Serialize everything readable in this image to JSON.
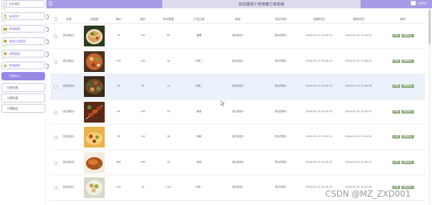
{
  "header": {
    "left_text": "美食\n系统",
    "title": "欢迎使用个体快餐订单系统",
    "user": "admin"
  },
  "sidebar": {
    "items": [
      {
        "label": "后台首页",
        "style": "normal"
      },
      {
        "label": "查询用户",
        "style": "purple"
      },
      {
        "label": "商城管理",
        "style": "purple"
      },
      {
        "label": "美食分类管理",
        "style": "purple"
      },
      {
        "label": "消费管理",
        "style": "purple"
      },
      {
        "label": "商城管理",
        "style": "purple"
      },
      {
        "label": "订餐中心",
        "style": "active"
      },
      {
        "label": "付账列表",
        "style": "sub"
      },
      {
        "label": "订餐列表",
        "style": "sub"
      },
      {
        "label": "订餐配送",
        "style": "sub"
      }
    ]
  },
  "table": {
    "columns": [
      "",
      "名称",
      "封面图",
      "单价",
      "原价",
      "库存数量",
      "产品分类",
      "描述",
      "购买须知",
      "创建时间",
      "更新时间",
      "操作"
    ],
    "buttons": {
      "detail": "详情",
      "review": "查看评论"
    },
    "rows": [
      {
        "name": "供应商品1",
        "price": "99",
        "orig": "130",
        "stock": "80",
        "category": "套餐",
        "desc": "供应商品1",
        "notice": "购买须知1",
        "created": "2024-01-23 12:25:13",
        "updated": "2024-01-23 12:31:22",
        "img": "dish-noodle"
      },
      {
        "name": "供应商品2",
        "price": "150",
        "orig": "220",
        "stock": "16",
        "category": "分类二",
        "desc": "供应商品2",
        "notice": "购买须知2",
        "created": "2024-01-23 12:25:13",
        "updated": "2024-01-23 12:28:45",
        "img": "dish-bowl"
      },
      {
        "name": "供应商品3",
        "price": "10",
        "orig": "20",
        "stock": "10",
        "category": "分类二",
        "desc": "供应商品3",
        "notice": "购买须知3",
        "created": "2024-01-23 12:25:13",
        "updated": "2024-01-23 12:28:55",
        "img": "dish-platter"
      },
      {
        "name": "供应商品4",
        "price": "99",
        "orig": "199",
        "stock": "20",
        "category": "套餐",
        "desc": "供应商品4",
        "notice": "购买须知4",
        "created": "2024-01-23 12:25:13",
        "updated": "2024-01-23 12:31:27",
        "img": "dish-skewer"
      },
      {
        "name": "供应商品5",
        "price": "99",
        "orig": "110",
        "stock": "36",
        "category": "海鲜",
        "desc": "供应商品5",
        "notice": "购买须知5",
        "created": "2024-01-23 12:25:13",
        "updated": "2024-01-23 12:31:32",
        "img": "dish-rice"
      },
      {
        "name": "供应商品6",
        "price": "888",
        "orig": "999",
        "stock": "40",
        "category": "烧鸡",
        "desc": "供应商品6",
        "notice": "购买须知6",
        "created": "2024-01-23 12:25:13",
        "updated": "2024-01-23 12:31:37",
        "img": "dish-chicken"
      },
      {
        "name": "供应商品7",
        "price": "220",
        "orig": "20",
        "stock": "116",
        "category": "分类一",
        "desc": "供应商品7",
        "notice": "购买须知7",
        "created": "2024-01-23 12:25:13",
        "updated": "2024-01-23 12:31:42",
        "img": "dish-salad"
      }
    ]
  },
  "watermark": "CSDN @MZ_ZXD001",
  "colors": {
    "accent": "#9889e6",
    "button": "#8aa878",
    "header_center": "#dcdcec"
  }
}
